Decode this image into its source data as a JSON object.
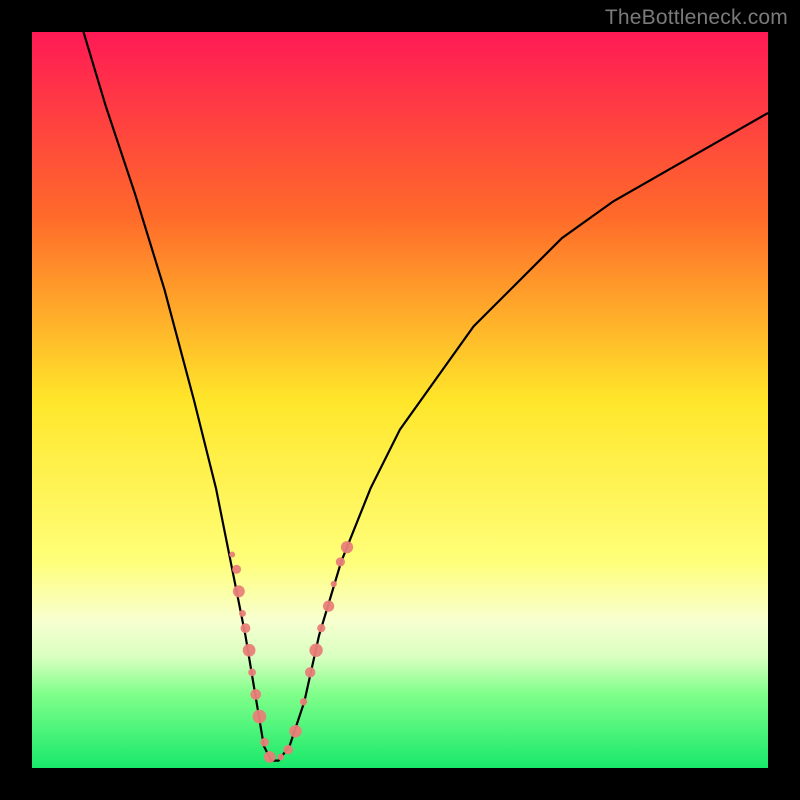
{
  "watermark": "TheBottleneck.com",
  "chart_data": {
    "type": "line",
    "title": "",
    "xlabel": "",
    "ylabel": "",
    "xlim": [
      0,
      100
    ],
    "ylim": [
      0,
      100
    ],
    "gradient_stops": [
      {
        "offset": 0,
        "color": "#ff1a55"
      },
      {
        "offset": 25,
        "color": "#ff6a2a"
      },
      {
        "offset": 50,
        "color": "#ffe62a"
      },
      {
        "offset": 72,
        "color": "#ffff7a"
      },
      {
        "offset": 80,
        "color": "#f7ffd0"
      },
      {
        "offset": 85,
        "color": "#d8ffc0"
      },
      {
        "offset": 90,
        "color": "#7fff8a"
      },
      {
        "offset": 100,
        "color": "#18e86a"
      }
    ],
    "series": [
      {
        "name": "bottleneck-curve",
        "x": [
          7,
          10,
          14,
          18,
          22,
          25,
          27,
          29,
          30.5,
          31.5,
          32.5,
          33.5,
          35,
          37,
          39,
          42,
          46,
          50,
          55,
          60,
          66,
          72,
          79,
          86,
          93,
          100
        ],
        "y": [
          100,
          90,
          78,
          65,
          50,
          38,
          28,
          18,
          9,
          3,
          1,
          1,
          3,
          9,
          18,
          28,
          38,
          46,
          53,
          60,
          66,
          72,
          77,
          81,
          85,
          89
        ]
      }
    ],
    "highlight_points": {
      "color": "#e98078",
      "radius_range": [
        3,
        7
      ],
      "points": [
        {
          "x": 27.2,
          "y": 29
        },
        {
          "x": 27.8,
          "y": 27
        },
        {
          "x": 28.1,
          "y": 24
        },
        {
          "x": 28.6,
          "y": 21
        },
        {
          "x": 29.0,
          "y": 19
        },
        {
          "x": 29.5,
          "y": 16
        },
        {
          "x": 29.9,
          "y": 13
        },
        {
          "x": 30.4,
          "y": 10
        },
        {
          "x": 30.9,
          "y": 7
        },
        {
          "x": 31.6,
          "y": 3.5
        },
        {
          "x": 32.3,
          "y": 1.5
        },
        {
          "x": 33.8,
          "y": 1.5
        },
        {
          "x": 34.8,
          "y": 2.5
        },
        {
          "x": 35.8,
          "y": 5
        },
        {
          "x": 36.9,
          "y": 9
        },
        {
          "x": 37.8,
          "y": 13
        },
        {
          "x": 38.6,
          "y": 16
        },
        {
          "x": 39.3,
          "y": 19
        },
        {
          "x": 40.3,
          "y": 22
        },
        {
          "x": 41.0,
          "y": 25
        },
        {
          "x": 41.9,
          "y": 28
        },
        {
          "x": 42.8,
          "y": 30
        }
      ]
    }
  }
}
